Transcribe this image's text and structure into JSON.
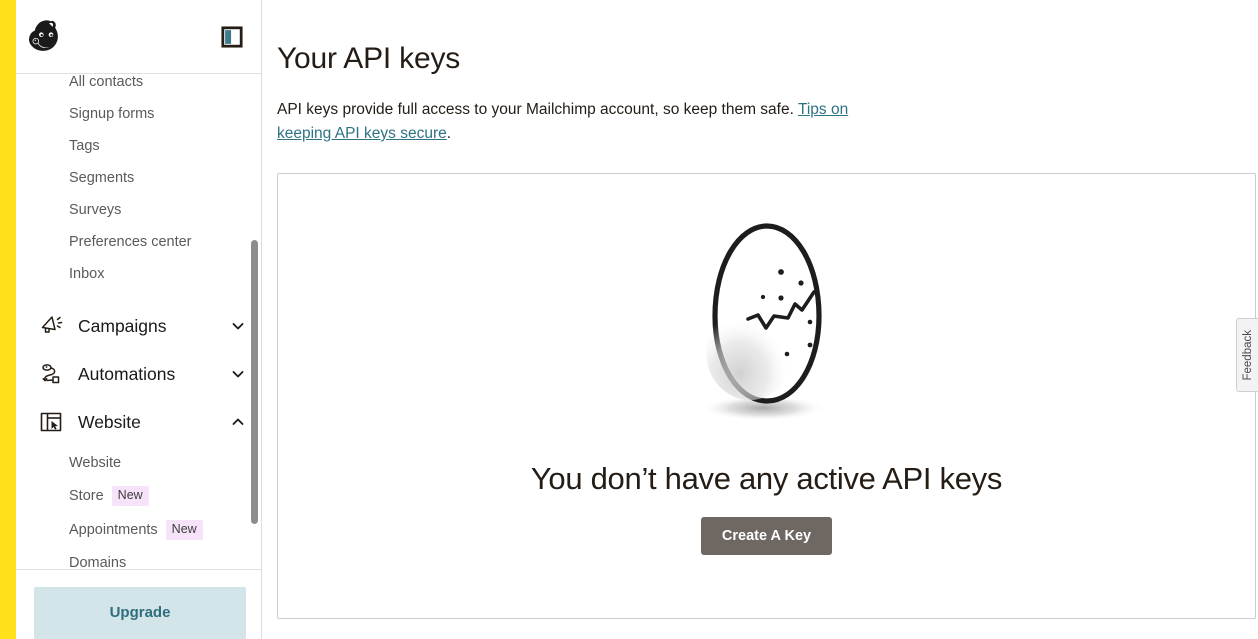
{
  "brand": {
    "logo_name": "mailchimp-freddie-logo",
    "rail_color": "#ffe01b",
    "accent_teal": "#2e7383",
    "upgrade_bg": "#d3e5e9",
    "badge_bg": "#f7e3f9",
    "button_gray": "#6f6762"
  },
  "sidebar": {
    "panel_toggle_name": "collapse-sidebar-icon",
    "sub_items_top": [
      {
        "label": "All contacts"
      },
      {
        "label": "Signup forms"
      },
      {
        "label": "Tags"
      },
      {
        "label": "Segments"
      },
      {
        "label": "Surveys"
      },
      {
        "label": "Preferences center"
      },
      {
        "label": "Inbox"
      }
    ],
    "groups": [
      {
        "label": "Campaigns",
        "icon": "megaphone-icon",
        "expanded": false,
        "chevron": "chevron-down-icon"
      },
      {
        "label": "Automations",
        "icon": "automation-flow-icon",
        "expanded": false,
        "chevron": "chevron-down-icon"
      },
      {
        "label": "Website",
        "icon": "website-window-icon",
        "expanded": true,
        "chevron": "chevron-up-icon"
      }
    ],
    "website_children": [
      {
        "label": "Website",
        "badge": ""
      },
      {
        "label": "Store",
        "badge": "New"
      },
      {
        "label": "Appointments",
        "badge": "New"
      },
      {
        "label": "Domains",
        "badge": ""
      }
    ],
    "upgrade_label": "Upgrade"
  },
  "main": {
    "title": "Your API keys",
    "description_before": "API keys provide full access to your Mailchimp account, so keep them safe. ",
    "description_link": "Tips on keeping API keys secure",
    "description_after": ".",
    "empty_state": {
      "illustration": "cracked-egg-illustration",
      "title": "You don’t have any active API keys",
      "button_label": "Create A Key"
    }
  },
  "feedback": {
    "label": "Feedback"
  }
}
